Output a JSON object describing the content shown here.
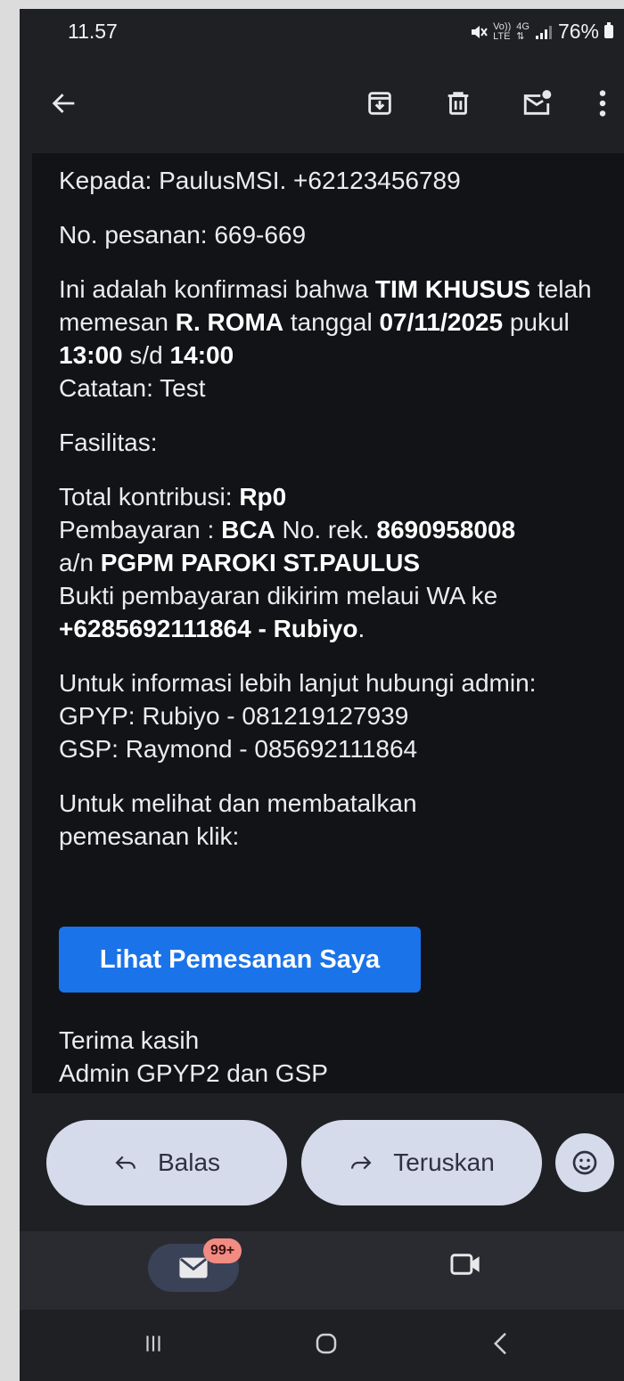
{
  "status_bar": {
    "time": "11.57",
    "network_top": "Vo))",
    "network_bottom": "LTE",
    "net_gen_top": "4G",
    "net_gen_bottom": "⇅",
    "battery": "76%"
  },
  "toolbar": {
    "back": "arrow-left-icon",
    "archive": "archive-icon",
    "delete": "trash-icon",
    "mark_unread": "mail-unread-icon",
    "more": "more-vert-icon"
  },
  "email": {
    "to_line": "Kepada: PaulusMSI. +62123456789",
    "order_line": "No. pesanan: 669-669",
    "confirm": {
      "p1": "Ini adalah konfirmasi bahwa ",
      "team": "TIM KHUSUS",
      "p2": " telah memesan ",
      "room": "R. ROMA",
      "p3": " tanggal ",
      "date": "07/11/2025",
      "p4": " pukul ",
      "start": "13:00",
      "p5": " s/d ",
      "end": "14:00"
    },
    "note": "Catatan: Test",
    "facilities": "Fasilitas:",
    "payment": {
      "total_label": "Total kontribusi: ",
      "total_value": "Rp0",
      "pay_label": "Pembayaran : ",
      "bank": "BCA",
      "acct_label": " No. rek. ",
      "acct": "8690958008",
      "an_label": "a/n ",
      "holder": "PGPM PAROKI ST.PAULUS",
      "proof_text": "Bukti pembayaran dikirim melaui WA ke",
      "proof_contact": "+6285692111864 - Rubiyo",
      "period": "."
    },
    "info": {
      "line1": "Untuk informasi lebih lanjut hubungi admin:",
      "gpyp": "GPYP: Rubiyo - 081219127939",
      "gsp": "GSP: Raymond - 085692111864"
    },
    "cancel_text": "Untuk melihat dan membatalkan pemesanan klik:",
    "cta_label": "Lihat Pemesanan Saya",
    "thanks": "Terima kasih",
    "signature": "Admin GPYP2 dan GSP"
  },
  "actions": {
    "reply": "Balas",
    "forward": "Teruskan",
    "emoji": "smiley-icon"
  },
  "bottom_nav": {
    "mail_badge": "99+",
    "mail": "mail-icon",
    "meet": "video-icon"
  },
  "system_nav": {
    "recents": "recents-icon",
    "home": "home-icon",
    "back": "back-icon"
  },
  "colors": {
    "background": "#1f2023",
    "content_bg": "#121317",
    "accent": "#1a73e8",
    "pill": "#d6dbeb",
    "badge": "#f28b82"
  }
}
